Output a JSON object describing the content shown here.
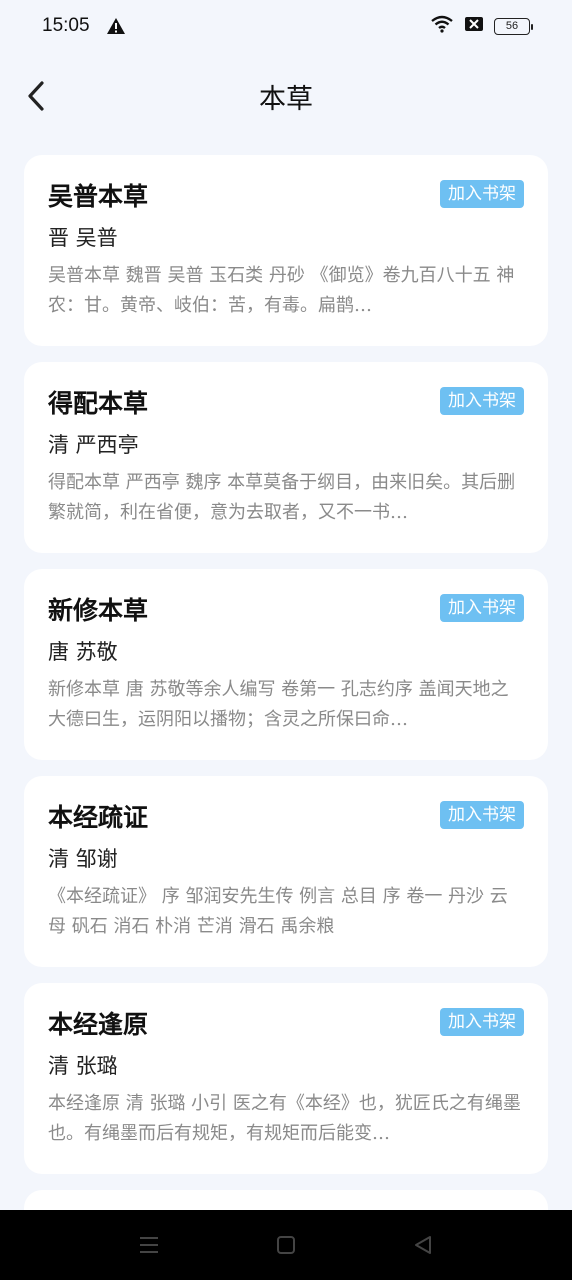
{
  "status_bar": {
    "time": "15:05",
    "battery": "56",
    "icons": [
      "warning-icon",
      "wifi-icon",
      "sim-blocked-icon",
      "battery-icon"
    ]
  },
  "header": {
    "title": "本草",
    "back_icon": "chevron-left-icon"
  },
  "books": [
    {
      "title": "吴普本草",
      "author": "晋 吴普",
      "excerpt": "吴普本草 魏晋 吴普 玉石类 丹砂 《御览》卷九百八十五 神农：甘。黄帝、岐伯：苦，有毒。扁鹊…",
      "button": "加入书架"
    },
    {
      "title": "得配本草",
      "author": "清 严西亭",
      "excerpt": "得配本草 严西亭 魏序 本草莫备于纲目，由来旧矣。其后删繁就简，利在省便，意为去取者，又不一书…",
      "button": "加入书架"
    },
    {
      "title": "新修本草",
      "author": "唐 苏敬",
      "excerpt": "新修本草 唐 苏敬等余人编写 卷第一 孔志约序 盖闻天地之大德曰生，运阴阳以播物；含灵之所保曰命…",
      "button": "加入书架"
    },
    {
      "title": "本经疏证",
      "author": "清 邹谢",
      "excerpt": "《本经疏证》 序 邹润安先生传 例言 总目 序 卷一 丹沙 云母 矾石 消石 朴消 芒消 滑石 禹余粮",
      "button": "加入书架"
    },
    {
      "title": "本经逢原",
      "author": "清 张璐",
      "excerpt": "本经逢原 清 张璐 小引 医之有《本经》也，犹匠氏之有绳墨也。有绳墨而后有规矩，有规矩而后能变…",
      "button": "加入书架"
    }
  ],
  "nav": {
    "icons": [
      "menu-icon",
      "home-icon",
      "back-triangle-icon"
    ]
  },
  "colors": {
    "background": "#f3f6fc",
    "card": "#ffffff",
    "accent_button": "#6ec0f2",
    "excerpt_text": "#8a8a8a"
  }
}
